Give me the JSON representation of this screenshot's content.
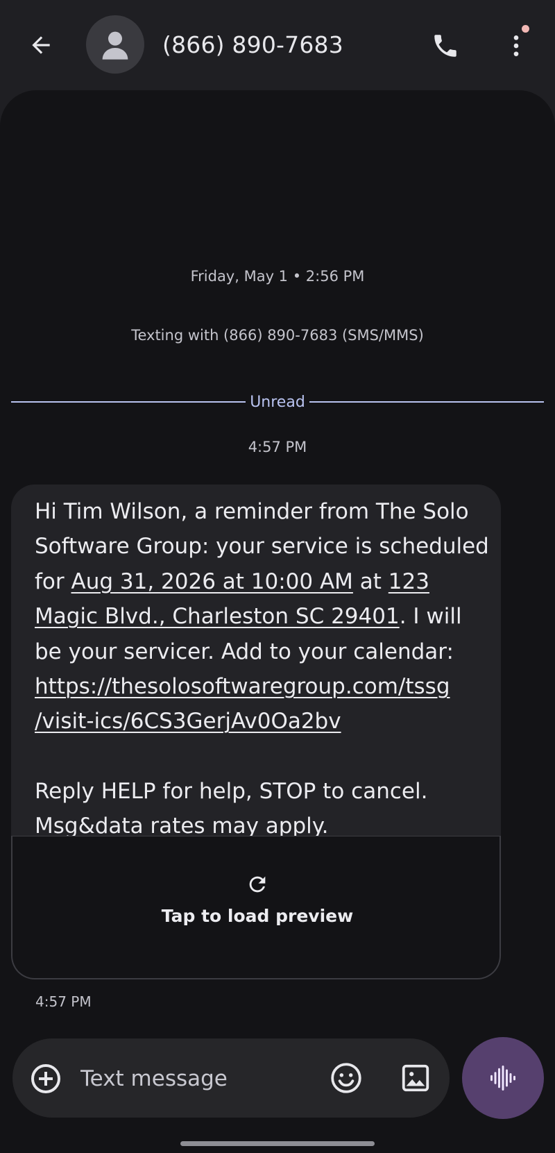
{
  "header": {
    "contact_title": "(866) 890-7683",
    "back_icon": "arrow-left-icon",
    "avatar_icon": "person-icon",
    "call_icon": "phone-icon",
    "more_icon": "more-vert-icon"
  },
  "conversation": {
    "date_stamp": "Friday, May 1 • 2:56 PM",
    "texting_with": "Texting with (866) 890-7683 (SMS/MMS)",
    "unread_label": "Unread",
    "unread_time": "4:57 PM",
    "message": {
      "part1": "Hi Tim Wilson, a reminder from The Solo Software Group: your service is scheduled for ",
      "date_link": "Aug 31, 2026 at 10:00 AM",
      "part2": " at ",
      "address_link": "123 Magic Blvd., Charleston SC 29401",
      "part3": ". I will be your servicer. Add to your calendar: ",
      "url_link": "https://thesolosoftwaregroup.com/tssg/visit-ics/6CS3GerjAv0Oa2bv",
      "footer": "Reply HELP for help, STOP to cancel. Msg&data rates may apply."
    },
    "preview": {
      "label": "Tap to load preview",
      "icon": "refresh-icon"
    },
    "message_time": "4:57 PM"
  },
  "compose": {
    "placeholder": "Text message",
    "value": "",
    "add_icon": "add-circle-icon",
    "emoji_icon": "emoji-icon",
    "gallery_icon": "image-icon",
    "voice_icon": "voice-waveform-icon"
  },
  "colors": {
    "background": "#131316",
    "header": "#1f1f23",
    "bubble": "#232327",
    "accent_divider": "#b9c3f0",
    "voice_button": "#56406e",
    "notification_dot": "#f2b8b5"
  }
}
